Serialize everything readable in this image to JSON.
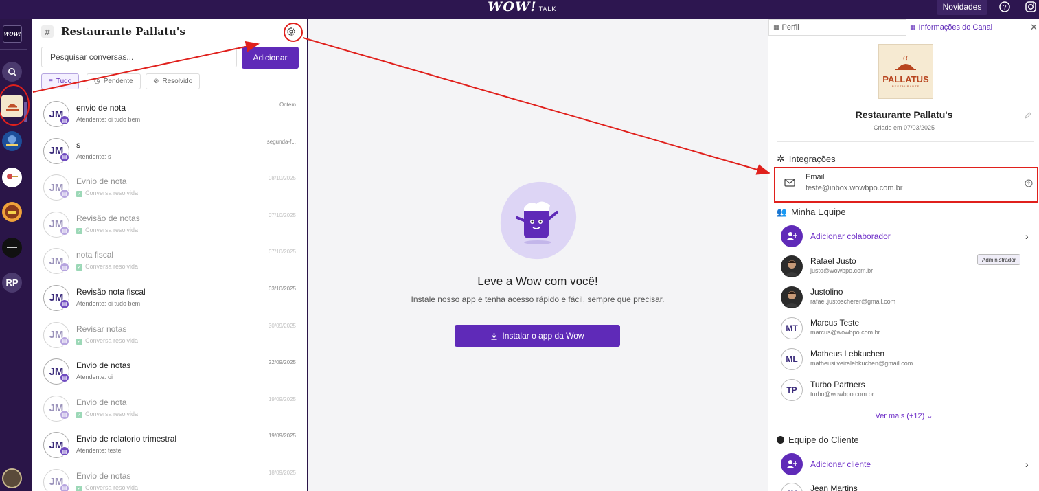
{
  "topbar": {
    "brand": "WOW!",
    "brand_suffix": "TALK",
    "novidades_label": "Novidades",
    "help_icon": "question-circle-icon",
    "instagram_icon": "instagram-icon"
  },
  "rail": {
    "logo_text": "WOW!",
    "search_icon": "search-icon",
    "workspaces": [
      {
        "name": "Pallatus",
        "color": "#f3e6cc",
        "text": "PALLATUS",
        "active": true
      },
      {
        "name": "Workspace 2",
        "color": "#1d4f9a",
        "text": ""
      },
      {
        "name": "Workspace 3",
        "color": "#ffffff",
        "text": ""
      },
      {
        "name": "Workspace 4",
        "color": "#f0a23a",
        "text": ""
      },
      {
        "name": "Workspace 5",
        "color": "#111111",
        "text": ""
      }
    ],
    "initials_workspace": "RP"
  },
  "conversations": {
    "channel_hash": "#",
    "title": "Restaurante Pallatu's",
    "search_placeholder": "Pesquisar conversas...",
    "add_label": "Adicionar",
    "filters": [
      {
        "label": "Tudo",
        "icon": "list-icon",
        "active": true
      },
      {
        "label": "Pendente",
        "icon": "clock-icon",
        "active": false
      },
      {
        "label": "Resolvido",
        "icon": "check-circle-icon",
        "active": false
      }
    ],
    "items": [
      {
        "initials": "JM",
        "title": "envio de nota",
        "subtitle": "Atendente: oi tudo bem",
        "date": "Ontem",
        "resolved": false
      },
      {
        "initials": "JM",
        "title": "s",
        "subtitle": "Atendente: s",
        "date": "segunda-f...",
        "resolved": false
      },
      {
        "initials": "JM",
        "title": "Evnio de nota",
        "subtitle": "Conversa resolvida",
        "date": "08/10/2025",
        "resolved": true
      },
      {
        "initials": "JM",
        "title": "Revisão de notas",
        "subtitle": "Conversa resolvida",
        "date": "07/10/2025",
        "resolved": true
      },
      {
        "initials": "JM",
        "title": "nota fiscal",
        "subtitle": "Conversa resolvida",
        "date": "07/10/2025",
        "resolved": true
      },
      {
        "initials": "JM",
        "title": "Revisão nota fiscal",
        "subtitle": "Atendente: oi tudo bem",
        "date": "03/10/2025",
        "resolved": false
      },
      {
        "initials": "JM",
        "title": "Revisar notas",
        "subtitle": "Conversa resolvida",
        "date": "30/09/2025",
        "resolved": true
      },
      {
        "initials": "JM",
        "title": "Envio de notas",
        "subtitle": "Atendente: oi",
        "date": "22/09/2025",
        "resolved": false
      },
      {
        "initials": "JM",
        "title": "Envio de nota",
        "subtitle": "Conversa resolvida",
        "date": "19/09/2025",
        "resolved": true
      },
      {
        "initials": "JM",
        "title": "Envio de relatorio trimestral",
        "subtitle": "Atendente: teste",
        "date": "19/09/2025",
        "resolved": false
      },
      {
        "initials": "JM",
        "title": "Envio de notas",
        "subtitle": "Conversa resolvida",
        "date": "18/09/2025",
        "resolved": true
      }
    ]
  },
  "center": {
    "heading": "Leve a Wow com você!",
    "subtext": "Instale nosso app e tenha acesso rápido e fácil, sempre que precisar.",
    "install_label": "Instalar o app da Wow",
    "install_icon": "download-icon"
  },
  "right_panel": {
    "tabs": [
      {
        "label": "Perfil",
        "icon": "grid-icon"
      },
      {
        "label": "Informações do Canal",
        "icon": "grid-icon",
        "active": true
      }
    ],
    "close_icon": "close-icon",
    "logo_name": "PALLATUS",
    "logo_sub": "RESTAURANTE",
    "channel_name": "Restaurante Pallatu's",
    "created": "Criado em 07/03/2025",
    "integrations_title": "Integrações",
    "email_integration": {
      "title": "Email",
      "value": "teste@inbox.wowbpo.com.br"
    },
    "team_title": "Minha Equipe",
    "add_collaborator": "Adicionar colaborador",
    "members": [
      {
        "name": "Rafael Justo",
        "email": "justo@wowbpo.com.br",
        "role": "Administrador",
        "avatar": "photo"
      },
      {
        "name": "Justolino",
        "email": "rafael.justoscherer@gmail.com",
        "role": "",
        "avatar": "photo"
      },
      {
        "name": "Marcus Teste",
        "email": "marcus@wowbpo.com.br",
        "initials": "MT",
        "role": "",
        "avatar": "initials"
      },
      {
        "name": "Matheus Lebkuchen",
        "email": "matheusilveiralebkuchen@gmail.com",
        "initials": "ML",
        "role": "",
        "avatar": "initials"
      },
      {
        "name": "Turbo Partners",
        "email": "turbo@wowbpo.com.br",
        "initials": "TP",
        "role": "",
        "avatar": "initials"
      }
    ],
    "see_more": "Ver mais (+12)",
    "client_team_title": "Equipe do Cliente",
    "add_client": "Adicionar cliente",
    "client_members": [
      {
        "name": "Jean Martins",
        "initials": "JM"
      }
    ]
  },
  "colors": {
    "brand_purple": "#5f2ab8",
    "topbar": "#2d1650",
    "annotation_red": "#e0201c"
  }
}
